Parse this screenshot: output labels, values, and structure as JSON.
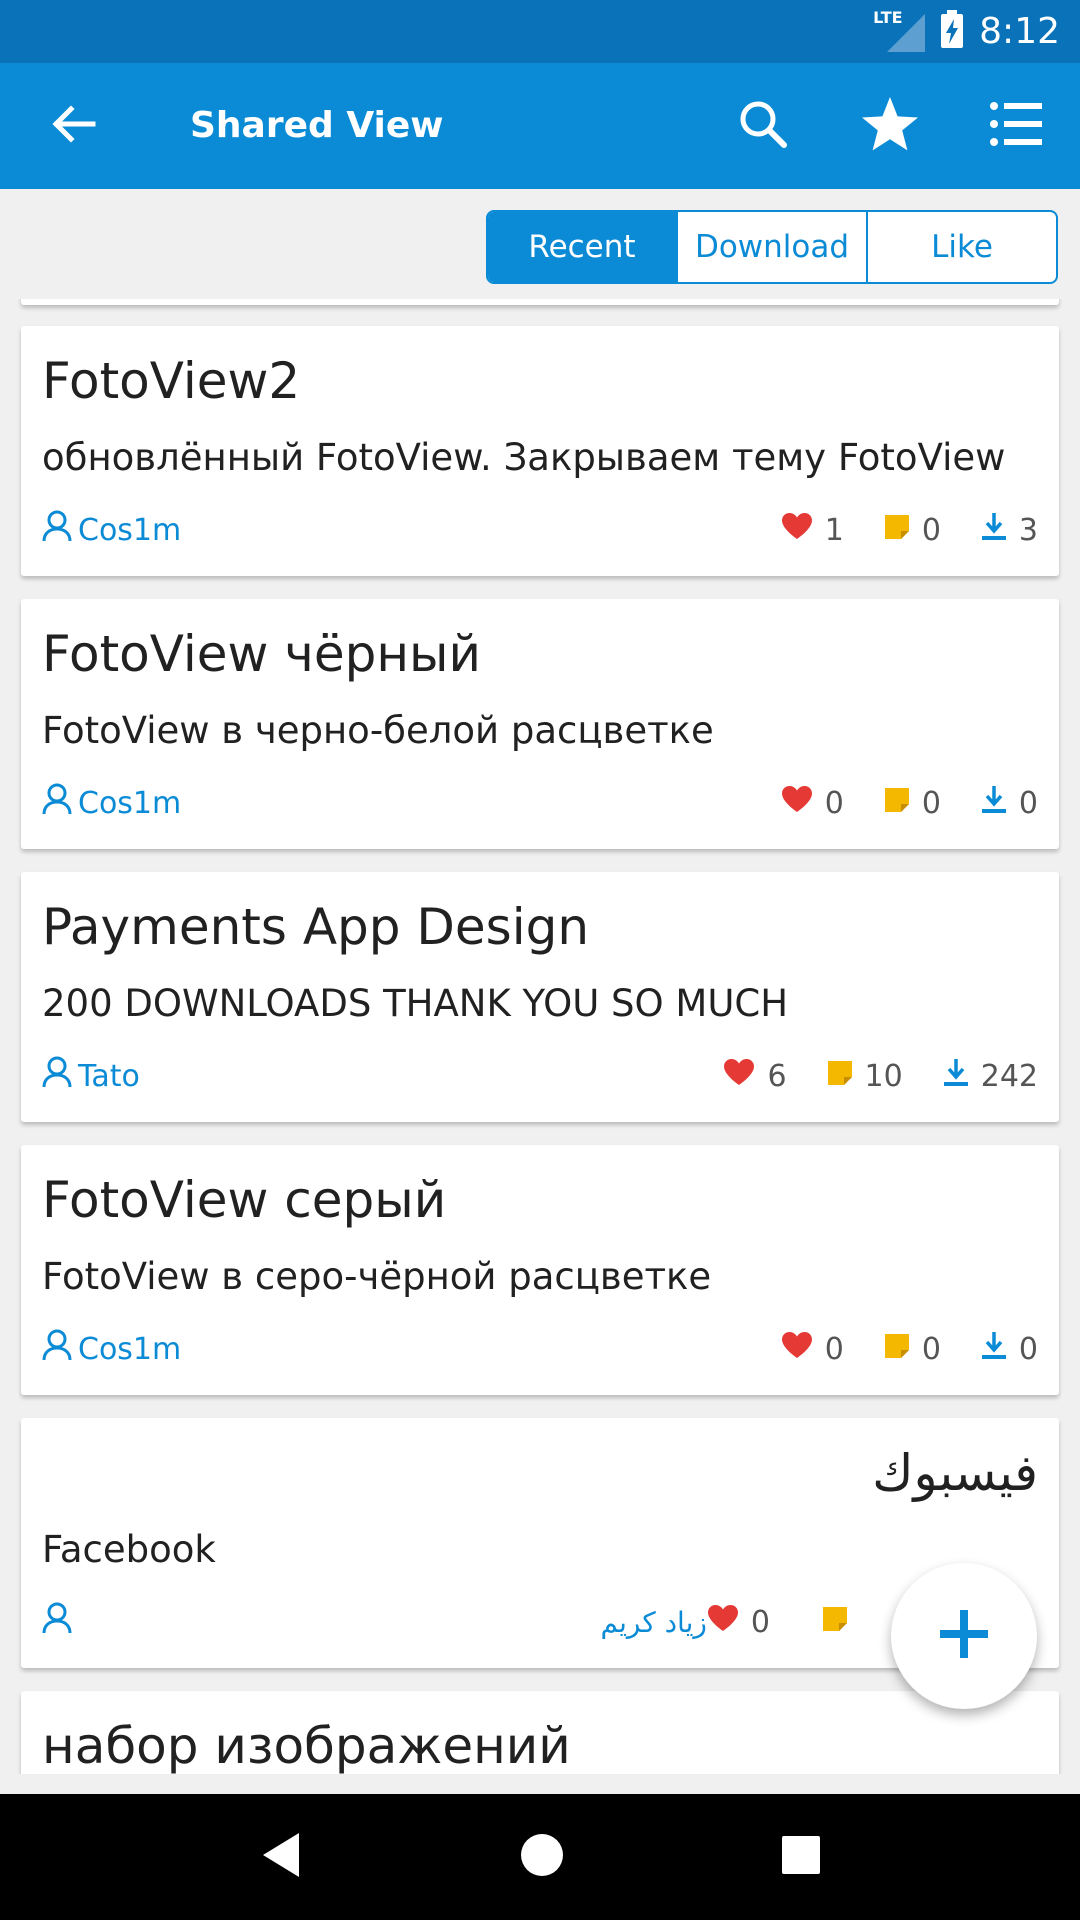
{
  "status": {
    "network": "LTE",
    "time": "8:12"
  },
  "appbar": {
    "title": "Shared View",
    "icons": [
      "back-arrow-icon",
      "search-icon",
      "star-icon",
      "list-icon"
    ]
  },
  "tabs": [
    {
      "label": "Recent",
      "active": true
    },
    {
      "label": "Download",
      "active": false
    },
    {
      "label": "Like",
      "active": false
    }
  ],
  "colors": {
    "primary": "#0b8bd6",
    "statusbar": "#0a72b8",
    "heart": "#e53935",
    "comment": "#f5b800",
    "download": "#0b8bd6"
  },
  "cards": [
    {
      "title": "FotoView2",
      "description": "обновлённый FotoView. Закрываем тему FotoView",
      "author": "Cos1m",
      "likes": "1",
      "comments": "0",
      "downloads": "3"
    },
    {
      "title": "FotoView чёрный",
      "description": "FotoView в черно-белой расцветке",
      "author": "Cos1m",
      "likes": "0",
      "comments": "0",
      "downloads": "0"
    },
    {
      "title": "Payments App Design",
      "description": "200 DOWNLOADS THANK YOU SO MUCH",
      "author": "Tato",
      "likes": "6",
      "comments": "10",
      "downloads": "242"
    },
    {
      "title": "FotoView серый",
      "description": "FotoView в серо-чёрной расцветке",
      "author": "Cos1m",
      "likes": "0",
      "comments": "0",
      "downloads": "0"
    },
    {
      "title": "فيسبوك",
      "description": "Facebook",
      "author": "زياد كريم",
      "likes": "0"
    },
    {
      "title": "набор изображений"
    }
  ],
  "fab": {
    "icon": "plus-icon"
  },
  "navbar": {
    "icons": [
      "back-triangle-icon",
      "home-circle-icon",
      "recents-square-icon"
    ]
  }
}
